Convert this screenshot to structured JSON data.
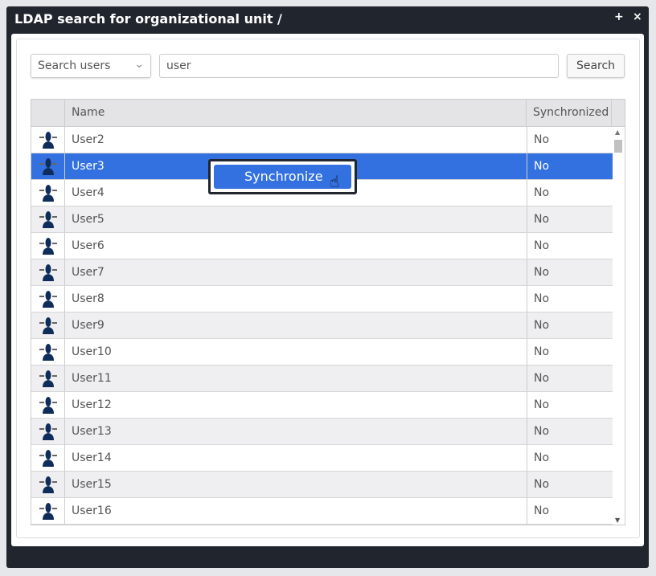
{
  "dialog": {
    "title": "LDAP search for organizational unit /",
    "maximize_icon": "+",
    "close_icon": "×"
  },
  "search": {
    "scope_selected": "Search users",
    "query": "user",
    "button": "Search"
  },
  "table": {
    "headers": [
      "",
      "Name",
      "Synchronized"
    ],
    "rows": [
      {
        "name": "User2",
        "synced": "No"
      },
      {
        "name": "User3",
        "synced": "No"
      },
      {
        "name": "User4",
        "synced": "No"
      },
      {
        "name": "User5",
        "synced": "No"
      },
      {
        "name": "User6",
        "synced": "No"
      },
      {
        "name": "User7",
        "synced": "No"
      },
      {
        "name": "User8",
        "synced": "No"
      },
      {
        "name": "User9",
        "synced": "No"
      },
      {
        "name": "User10",
        "synced": "No"
      },
      {
        "name": "User11",
        "synced": "No"
      },
      {
        "name": "User12",
        "synced": "No"
      },
      {
        "name": "User13",
        "synced": "No"
      },
      {
        "name": "User14",
        "synced": "No"
      },
      {
        "name": "User15",
        "synced": "No"
      },
      {
        "name": "User16",
        "synced": "No"
      }
    ],
    "selected_row": "User3"
  },
  "context_menu": {
    "items": [
      {
        "label": "Synchronize"
      }
    ]
  },
  "colors": {
    "accent": "#3471e0",
    "titlebar": "#21252d",
    "icon": "#0f2d5a"
  }
}
